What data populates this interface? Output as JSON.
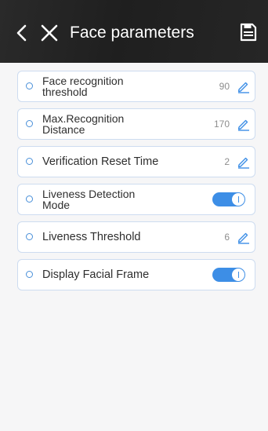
{
  "header": {
    "title": "Face parameters",
    "background_color": "#222222",
    "icons": {
      "back": "chevron-left-icon",
      "close": "close-icon",
      "save": "save-icon"
    }
  },
  "accent_color": "#3d8ee6",
  "settings": [
    {
      "label": "Face recognition\nthreshold",
      "value": "90",
      "control": "edit"
    },
    {
      "label": "Max.Recognition\nDistance",
      "value": "170",
      "control": "edit"
    },
    {
      "label": "Verification Reset Time",
      "value": "2",
      "control": "edit"
    },
    {
      "label": "Liveness Detection\nMode",
      "value": "on",
      "control": "toggle"
    },
    {
      "label": "Liveness Threshold",
      "value": "6",
      "control": "edit"
    },
    {
      "label": "Display Facial Frame",
      "value": "on",
      "control": "toggle"
    }
  ]
}
